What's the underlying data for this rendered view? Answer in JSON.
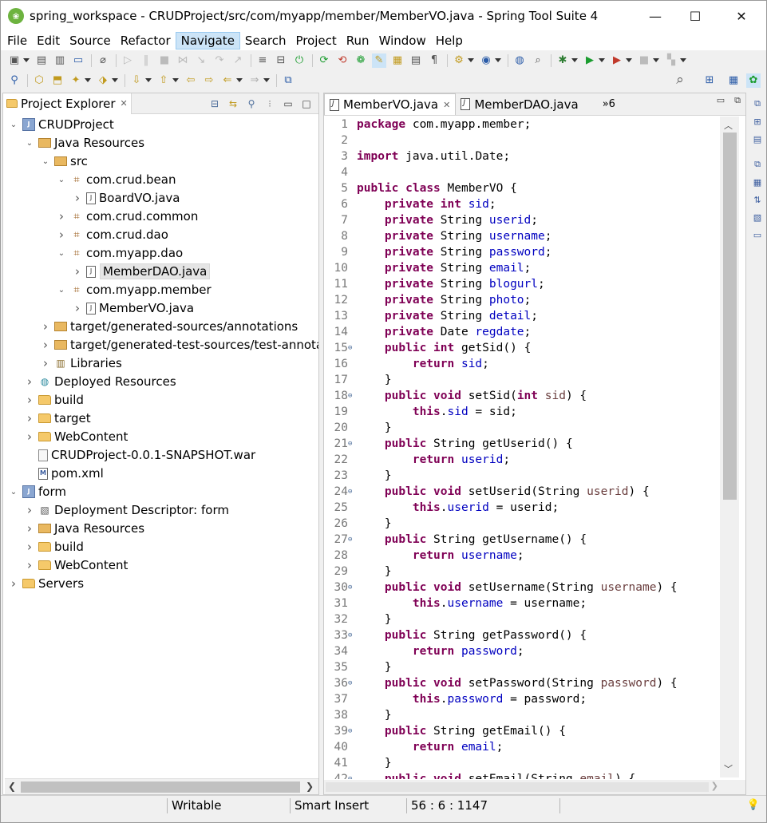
{
  "window": {
    "title": "spring_workspace - CRUDProject/src/com/myapp/member/MemberVO.java - Spring Tool Suite 4",
    "minimize": "—",
    "maximize": "☐",
    "close": "✕"
  },
  "menu": [
    "File",
    "Edit",
    "Source",
    "Refactor",
    "Navigate",
    "Search",
    "Project",
    "Run",
    "Window",
    "Help"
  ],
  "menu_active": "Navigate",
  "explorer": {
    "title": "Project Explorer",
    "tree": [
      {
        "label": "CRUDProject",
        "depth": 0,
        "twisty": "open",
        "icon": "proj"
      },
      {
        "label": "Java Resources",
        "depth": 1,
        "twisty": "open",
        "icon": "srcf"
      },
      {
        "label": "src",
        "depth": 2,
        "twisty": "open",
        "icon": "srcf"
      },
      {
        "label": "com.crud.bean",
        "depth": 3,
        "twisty": "open",
        "icon": "pkg"
      },
      {
        "label": "BoardVO.java",
        "depth": 4,
        "twisty": "closed",
        "icon": "file"
      },
      {
        "label": "com.crud.common",
        "depth": 3,
        "twisty": "closed",
        "icon": "pkg"
      },
      {
        "label": "com.crud.dao",
        "depth": 3,
        "twisty": "closed",
        "icon": "pkg"
      },
      {
        "label": "com.myapp.dao",
        "depth": 3,
        "twisty": "open",
        "icon": "pkg"
      },
      {
        "label": "MemberDAO.java",
        "depth": 4,
        "twisty": "closed",
        "icon": "file",
        "selected": true
      },
      {
        "label": "com.myapp.member",
        "depth": 3,
        "twisty": "open",
        "icon": "pkg"
      },
      {
        "label": "MemberVO.java",
        "depth": 4,
        "twisty": "closed",
        "icon": "file"
      },
      {
        "label": "target/generated-sources/annotations",
        "depth": 2,
        "twisty": "closed",
        "icon": "srcf"
      },
      {
        "label": "target/generated-test-sources/test-annotation",
        "depth": 2,
        "twisty": "closed",
        "icon": "srcf"
      },
      {
        "label": "Libraries",
        "depth": 2,
        "twisty": "closed",
        "icon": "lib"
      },
      {
        "label": "Deployed Resources",
        "depth": 1,
        "twisty": "closed",
        "icon": "globe"
      },
      {
        "label": "build",
        "depth": 1,
        "twisty": "closed",
        "icon": "folder"
      },
      {
        "label": "target",
        "depth": 1,
        "twisty": "closed",
        "icon": "folder"
      },
      {
        "label": "WebContent",
        "depth": 1,
        "twisty": "closed",
        "icon": "folder"
      },
      {
        "label": "CRUDProject-0.0.1-SNAPSHOT.war",
        "depth": 1,
        "twisty": "none",
        "icon": "war"
      },
      {
        "label": "pom.xml",
        "depth": 1,
        "twisty": "none",
        "icon": "pom"
      },
      {
        "label": "form",
        "depth": 0,
        "twisty": "open",
        "icon": "proj"
      },
      {
        "label": "Deployment Descriptor: form",
        "depth": 1,
        "twisty": "closed",
        "icon": "dd"
      },
      {
        "label": "Java Resources",
        "depth": 1,
        "twisty": "closed",
        "icon": "srcf"
      },
      {
        "label": "build",
        "depth": 1,
        "twisty": "closed",
        "icon": "folder"
      },
      {
        "label": "WebContent",
        "depth": 1,
        "twisty": "closed",
        "icon": "folder"
      },
      {
        "label": "Servers",
        "depth": 0,
        "twisty": "closed",
        "icon": "folder"
      }
    ]
  },
  "editor": {
    "tabs": [
      {
        "label": "MemberVO.java",
        "active": true
      },
      {
        "label": "MemberDAO.java",
        "active": false
      }
    ],
    "overflow": "»6",
    "lines": [
      {
        "n": "1",
        "fold": false,
        "text": "package com.myapp.member;"
      },
      {
        "n": "2",
        "fold": false,
        "text": ""
      },
      {
        "n": "3",
        "fold": false,
        "text": "import java.util.Date;"
      },
      {
        "n": "4",
        "fold": false,
        "text": ""
      },
      {
        "n": "5",
        "fold": false,
        "text": "public class MemberVO {"
      },
      {
        "n": "6",
        "fold": false,
        "text": "    private int sid;"
      },
      {
        "n": "7",
        "fold": false,
        "text": "    private String userid;"
      },
      {
        "n": "8",
        "fold": false,
        "text": "    private String username;"
      },
      {
        "n": "9",
        "fold": false,
        "text": "    private String password;"
      },
      {
        "n": "10",
        "fold": false,
        "text": "    private String email;"
      },
      {
        "n": "11",
        "fold": false,
        "text": "    private String blogurl;"
      },
      {
        "n": "12",
        "fold": false,
        "text": "    private String photo;"
      },
      {
        "n": "13",
        "fold": false,
        "text": "    private String detail;"
      },
      {
        "n": "14",
        "fold": false,
        "text": "    private Date regdate;"
      },
      {
        "n": "15",
        "fold": true,
        "text": "    public int getSid() {"
      },
      {
        "n": "16",
        "fold": false,
        "text": "        return sid;"
      },
      {
        "n": "17",
        "fold": false,
        "text": "    }"
      },
      {
        "n": "18",
        "fold": true,
        "text": "    public void setSid(int sid) {"
      },
      {
        "n": "19",
        "fold": false,
        "text": "        this.sid = sid;"
      },
      {
        "n": "20",
        "fold": false,
        "text": "    }"
      },
      {
        "n": "21",
        "fold": true,
        "text": "    public String getUserid() {"
      },
      {
        "n": "22",
        "fold": false,
        "text": "        return userid;"
      },
      {
        "n": "23",
        "fold": false,
        "text": "    }"
      },
      {
        "n": "24",
        "fold": true,
        "text": "    public void setUserid(String userid) {"
      },
      {
        "n": "25",
        "fold": false,
        "text": "        this.userid = userid;"
      },
      {
        "n": "26",
        "fold": false,
        "text": "    }"
      },
      {
        "n": "27",
        "fold": true,
        "text": "    public String getUsername() {"
      },
      {
        "n": "28",
        "fold": false,
        "text": "        return username;"
      },
      {
        "n": "29",
        "fold": false,
        "text": "    }"
      },
      {
        "n": "30",
        "fold": true,
        "text": "    public void setUsername(String username) {"
      },
      {
        "n": "31",
        "fold": false,
        "text": "        this.username = username;"
      },
      {
        "n": "32",
        "fold": false,
        "text": "    }"
      },
      {
        "n": "33",
        "fold": true,
        "text": "    public String getPassword() {"
      },
      {
        "n": "34",
        "fold": false,
        "text": "        return password;"
      },
      {
        "n": "35",
        "fold": false,
        "text": "    }"
      },
      {
        "n": "36",
        "fold": true,
        "text": "    public void setPassword(String password) {"
      },
      {
        "n": "37",
        "fold": false,
        "text": "        this.password = password;"
      },
      {
        "n": "38",
        "fold": false,
        "text": "    }"
      },
      {
        "n": "39",
        "fold": true,
        "text": "    public String getEmail() {"
      },
      {
        "n": "40",
        "fold": false,
        "text": "        return email;"
      },
      {
        "n": "41",
        "fold": false,
        "text": "    }"
      },
      {
        "n": "42",
        "fold": true,
        "text": "    public void setEmail(String email) {"
      }
    ],
    "fields": [
      "sid",
      "userid",
      "username",
      "password",
      "email",
      "blogurl",
      "photo",
      "detail",
      "regdate"
    ],
    "keywords": [
      "package",
      "import",
      "public",
      "class",
      "private",
      "int",
      "return",
      "void",
      "this"
    ]
  },
  "status": {
    "writable": "Writable",
    "insert_mode": "Smart Insert",
    "position": "56 : 6 : 1147"
  },
  "colors": {
    "keyword": "#7f0055",
    "field": "#0000c0",
    "param": "#6a3e3e",
    "selection": "#cce4f7"
  }
}
